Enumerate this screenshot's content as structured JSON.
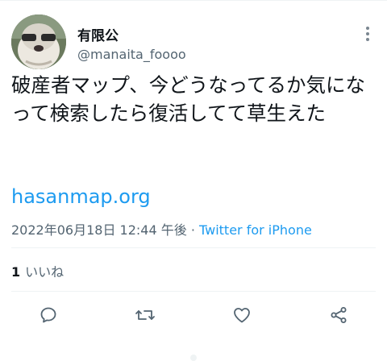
{
  "user": {
    "display_name": "有限公",
    "handle": "@manaita_foooo"
  },
  "tweet": {
    "text": "破産者マップ、今どうなってるか気になって検索したら復活してて草生えた",
    "link": "hasanmap.org",
    "timestamp": "2022年06月18日 12:44 午後",
    "separator": " · ",
    "source": "Twitter for iPhone"
  },
  "stats": {
    "likes_count": "1",
    "likes_label": "いいね"
  },
  "icons": {
    "more": "more-vertical-icon",
    "reply": "reply-icon",
    "retweet": "retweet-icon",
    "like": "heart-icon",
    "share": "share-icon"
  },
  "colors": {
    "link": "#1d9bf0",
    "text": "#0f1419",
    "secondary": "#536471",
    "divider": "#eff3f4"
  }
}
